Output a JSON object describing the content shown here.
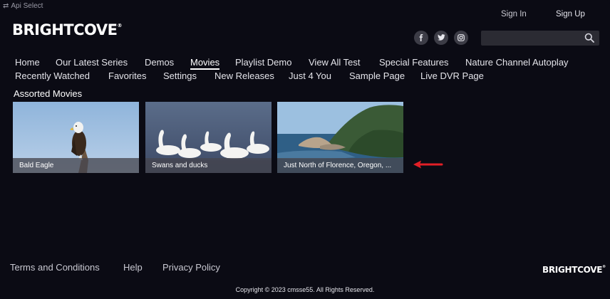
{
  "header": {
    "api_select": "Api Select",
    "logo": "BRIGHTCOVE",
    "sign_in": "Sign In",
    "sign_up": "Sign Up",
    "social": {
      "facebook": "f",
      "twitter": "t",
      "instagram": "ig"
    },
    "search_placeholder": ""
  },
  "nav": {
    "row1": [
      "Home",
      "Our Latest Series",
      "Demos",
      "Movies",
      "Playlist Demo",
      "View All Test",
      "Special Features",
      "Nature Channel Autoplay"
    ],
    "row2": [
      "Recently Watched",
      "Favorites",
      "Settings",
      "New Releases",
      "Just 4 You",
      "Sample Page",
      "Live DVR Page"
    ],
    "active": "Movies"
  },
  "section": {
    "title": "Assorted Movies",
    "tiles": [
      {
        "label": "Bald Eagle"
      },
      {
        "label": "Swans and ducks"
      },
      {
        "label": "Just North of Florence, Oregon, ..."
      }
    ]
  },
  "footer": {
    "links": [
      "Terms and Conditions",
      "Help",
      "Privacy Policy"
    ],
    "logo": "BRIGHTCOVE",
    "copyright": "Copyright © 2023 cmsse55. All Rights Reserved."
  },
  "colors": {
    "background": "#0b0b14",
    "arrow": "#e21f26",
    "search_bg": "#2b2b33"
  },
  "icons": [
    "swap-icon",
    "facebook-icon",
    "twitter-icon",
    "instagram-icon",
    "search-icon",
    "red-arrow-icon"
  ]
}
